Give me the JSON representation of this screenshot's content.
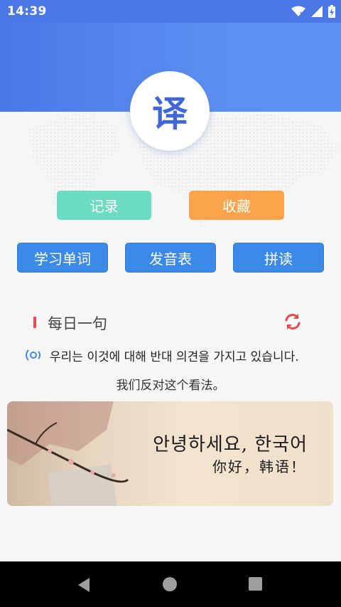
{
  "status_bar": {
    "time": "14:39",
    "icons": [
      "wifi-icon",
      "signal-icon",
      "battery-charging-icon"
    ]
  },
  "logo": {
    "char": "译"
  },
  "actions": {
    "record_label": "记录",
    "favorites_label": "收藏",
    "study_words_label": "学习单词",
    "pronunciation_table_label": "发音表",
    "spelling_label": "拼读"
  },
  "daily": {
    "title": "每日一句",
    "sentence_ko": "우리는 이것에 대해 반대 의견을 가지고 있습니다.",
    "sentence_zh": "我们反对这个看法。"
  },
  "banner": {
    "ko": "안녕하세요, 한국어",
    "zh": "你好，韩语！"
  },
  "colors": {
    "header_blue": "#4a78e6",
    "record_green": "#6bdcc0",
    "favorite_orange": "#fba34a",
    "action_blue": "#3b8ae9",
    "accent_red": "#e94b4b"
  }
}
